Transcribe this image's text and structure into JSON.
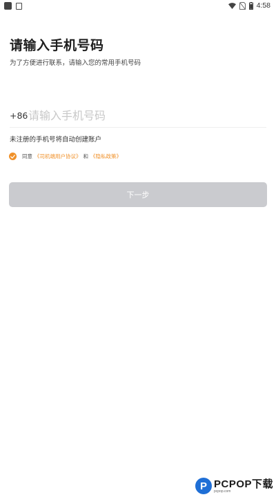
{
  "status_bar": {
    "time": "4:58",
    "icons": [
      "notification-square-icon",
      "notification-box-icon",
      "wifi-icon",
      "no-sim-icon",
      "battery-icon"
    ]
  },
  "title": "请输入手机号码",
  "subtitle": "为了方便进行联系，请输入您的常用手机号码",
  "phone": {
    "country_code": "+86",
    "value": "",
    "placeholder": "请输入手机号码"
  },
  "hint": "未注册的手机号将自动创建账户",
  "agreement": {
    "checked": true,
    "prefix": "同意",
    "link1": "《司机端用户协议》",
    "conjunction": "和",
    "link2": "《隐私政策》"
  },
  "next_button": {
    "label": "下一步",
    "enabled": false
  },
  "colors": {
    "accent": "#f0912a",
    "button_disabled": "#cacbcf",
    "placeholder": "#c8c8c8"
  },
  "watermark": {
    "logo_letter": "P",
    "name": "PCPOP下载",
    "sub": "pcpop.com"
  }
}
